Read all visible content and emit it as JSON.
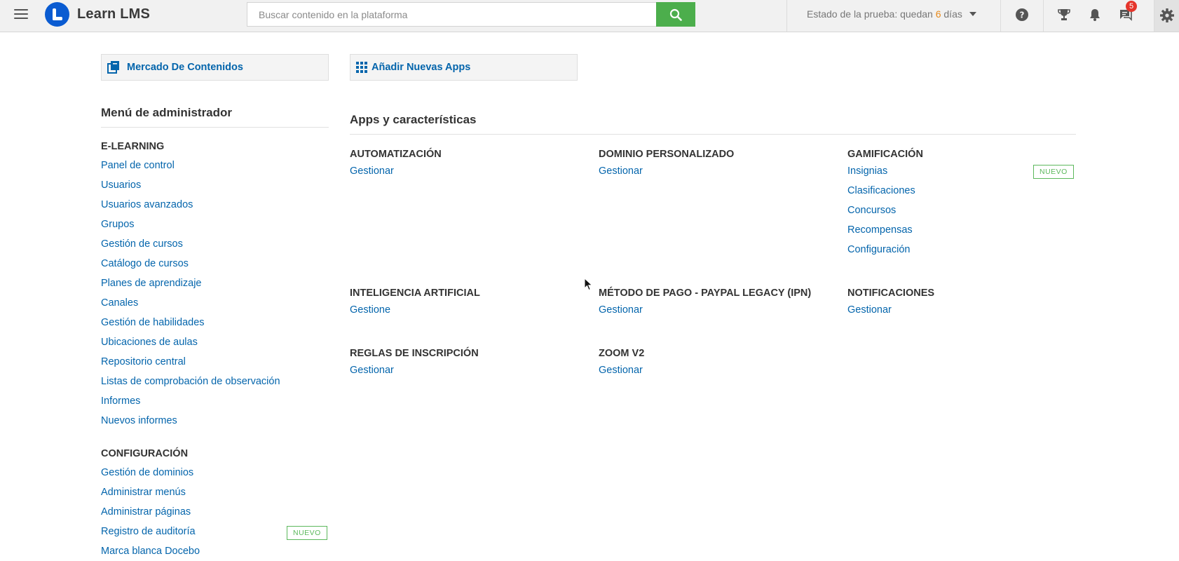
{
  "topbar": {
    "app_name": "Learn LMS",
    "search_placeholder": "Buscar contenido en la plataforma",
    "trial_prefix": "Estado de la prueba: quedan",
    "trial_days": "6",
    "trial_suffix": "días",
    "messages_badge": "5",
    "icons": [
      "menu-icon",
      "search-icon",
      "help-icon",
      "trophy-icon",
      "bell-icon",
      "chat-icon",
      "gear-icon"
    ]
  },
  "shortcuts": {
    "marketplace_label": "Mercado De Contenidos",
    "add_apps_label": "Añadir Nuevas Apps"
  },
  "admin_menu": {
    "title": "Menú de administrador",
    "elearning": {
      "heading": "E-LEARNING",
      "items": [
        "Panel de control",
        "Usuarios",
        "Usuarios avanzados",
        "Grupos",
        "Gestión de cursos",
        "Catálogo de cursos",
        "Planes de aprendizaje",
        "Canales",
        "Gestión de habilidades",
        "Ubicaciones de aulas",
        "Repositorio central",
        "Listas de comprobación de observación",
        "Informes",
        "Nuevos informes"
      ]
    },
    "configuracion": {
      "heading": "CONFIGURACIÓN",
      "items": [
        "Gestión de dominios",
        "Administrar menús",
        "Administrar páginas",
        "Registro de auditoría",
        "Marca blanca Docebo"
      ]
    },
    "new_badge": "NUEVO"
  },
  "apps": {
    "title": "Apps y características",
    "automatizacion": {
      "heading": "AUTOMATIZACIÓN",
      "link": "Gestionar"
    },
    "dominio": {
      "heading": "DOMINIO PERSONALIZADO",
      "link": "Gestionar"
    },
    "gamificacion": {
      "heading": "GAMIFICACIÓN",
      "links": [
        "Insignias",
        "Clasificaciones",
        "Concursos",
        "Recompensas",
        "Configuración"
      ],
      "new_badge": "NUEVO"
    },
    "ia": {
      "heading": "INTELIGENCIA ARTIFICIAL",
      "link": "Gestione"
    },
    "paypal": {
      "heading": "MÉTODO DE PAGO - PAYPAL LEGACY (IPN)",
      "link": "Gestionar"
    },
    "notificaciones": {
      "heading": "NOTIFICACIONES",
      "link": "Gestionar"
    },
    "reglas": {
      "heading": "REGLAS DE INSCRIPCIÓN",
      "link": "Gestionar"
    },
    "zoom": {
      "heading": "ZOOM V2",
      "link": "Gestionar"
    }
  },
  "colors": {
    "link": "#0465ac",
    "search_button": "#4cae4c",
    "new_badge": "#5cb85c",
    "trial_days": "#e88a1a",
    "notification_badge": "#e5352b",
    "logo": "#0a5bd1"
  }
}
